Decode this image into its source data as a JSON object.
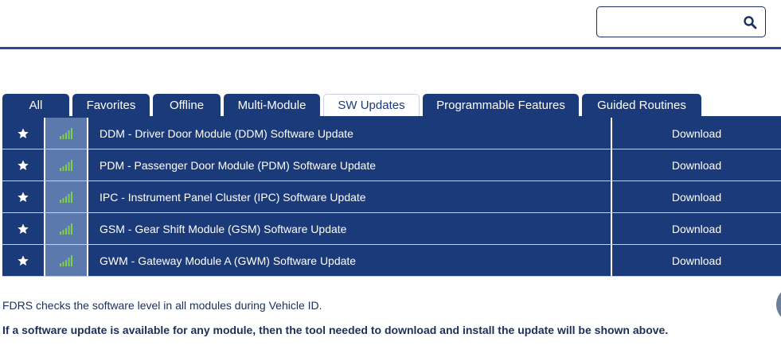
{
  "search": {
    "value": "",
    "placeholder": "",
    "icon": "search-icon"
  },
  "tabs": [
    {
      "label": "All",
      "active": false
    },
    {
      "label": "Favorites",
      "active": false
    },
    {
      "label": "Offline",
      "active": false
    },
    {
      "label": "Multi-Module",
      "active": false
    },
    {
      "label": "SW Updates",
      "active": true
    },
    {
      "label": "Programmable Features",
      "active": false
    },
    {
      "label": "Guided Routines",
      "active": false
    }
  ],
  "rows": [
    {
      "name": "DDM - Driver Door Module (DDM) Software Update",
      "action": "Download"
    },
    {
      "name": "PDM - Passenger Door Module (PDM) Software Update",
      "action": "Download"
    },
    {
      "name": "IPC - Instrument Panel Cluster (IPC) Software Update",
      "action": "Download"
    },
    {
      "name": "GSM - Gear Shift Module (GSM) Software Update",
      "action": "Download"
    },
    {
      "name": "GWM - Gateway Module A (GWM) Software Update",
      "action": "Download"
    }
  ],
  "notes": {
    "line1": "FDRS checks the software level in all modules during Vehicle ID.",
    "line2": "If a software update is available for any module, then the tool needed to download and install the update will be shown above."
  },
  "colors": {
    "primary": "#1b3a7a",
    "signal_cell": "#5b79ad",
    "signal_bars": "#7ed04b",
    "accent_line": "#2b4a8b"
  }
}
